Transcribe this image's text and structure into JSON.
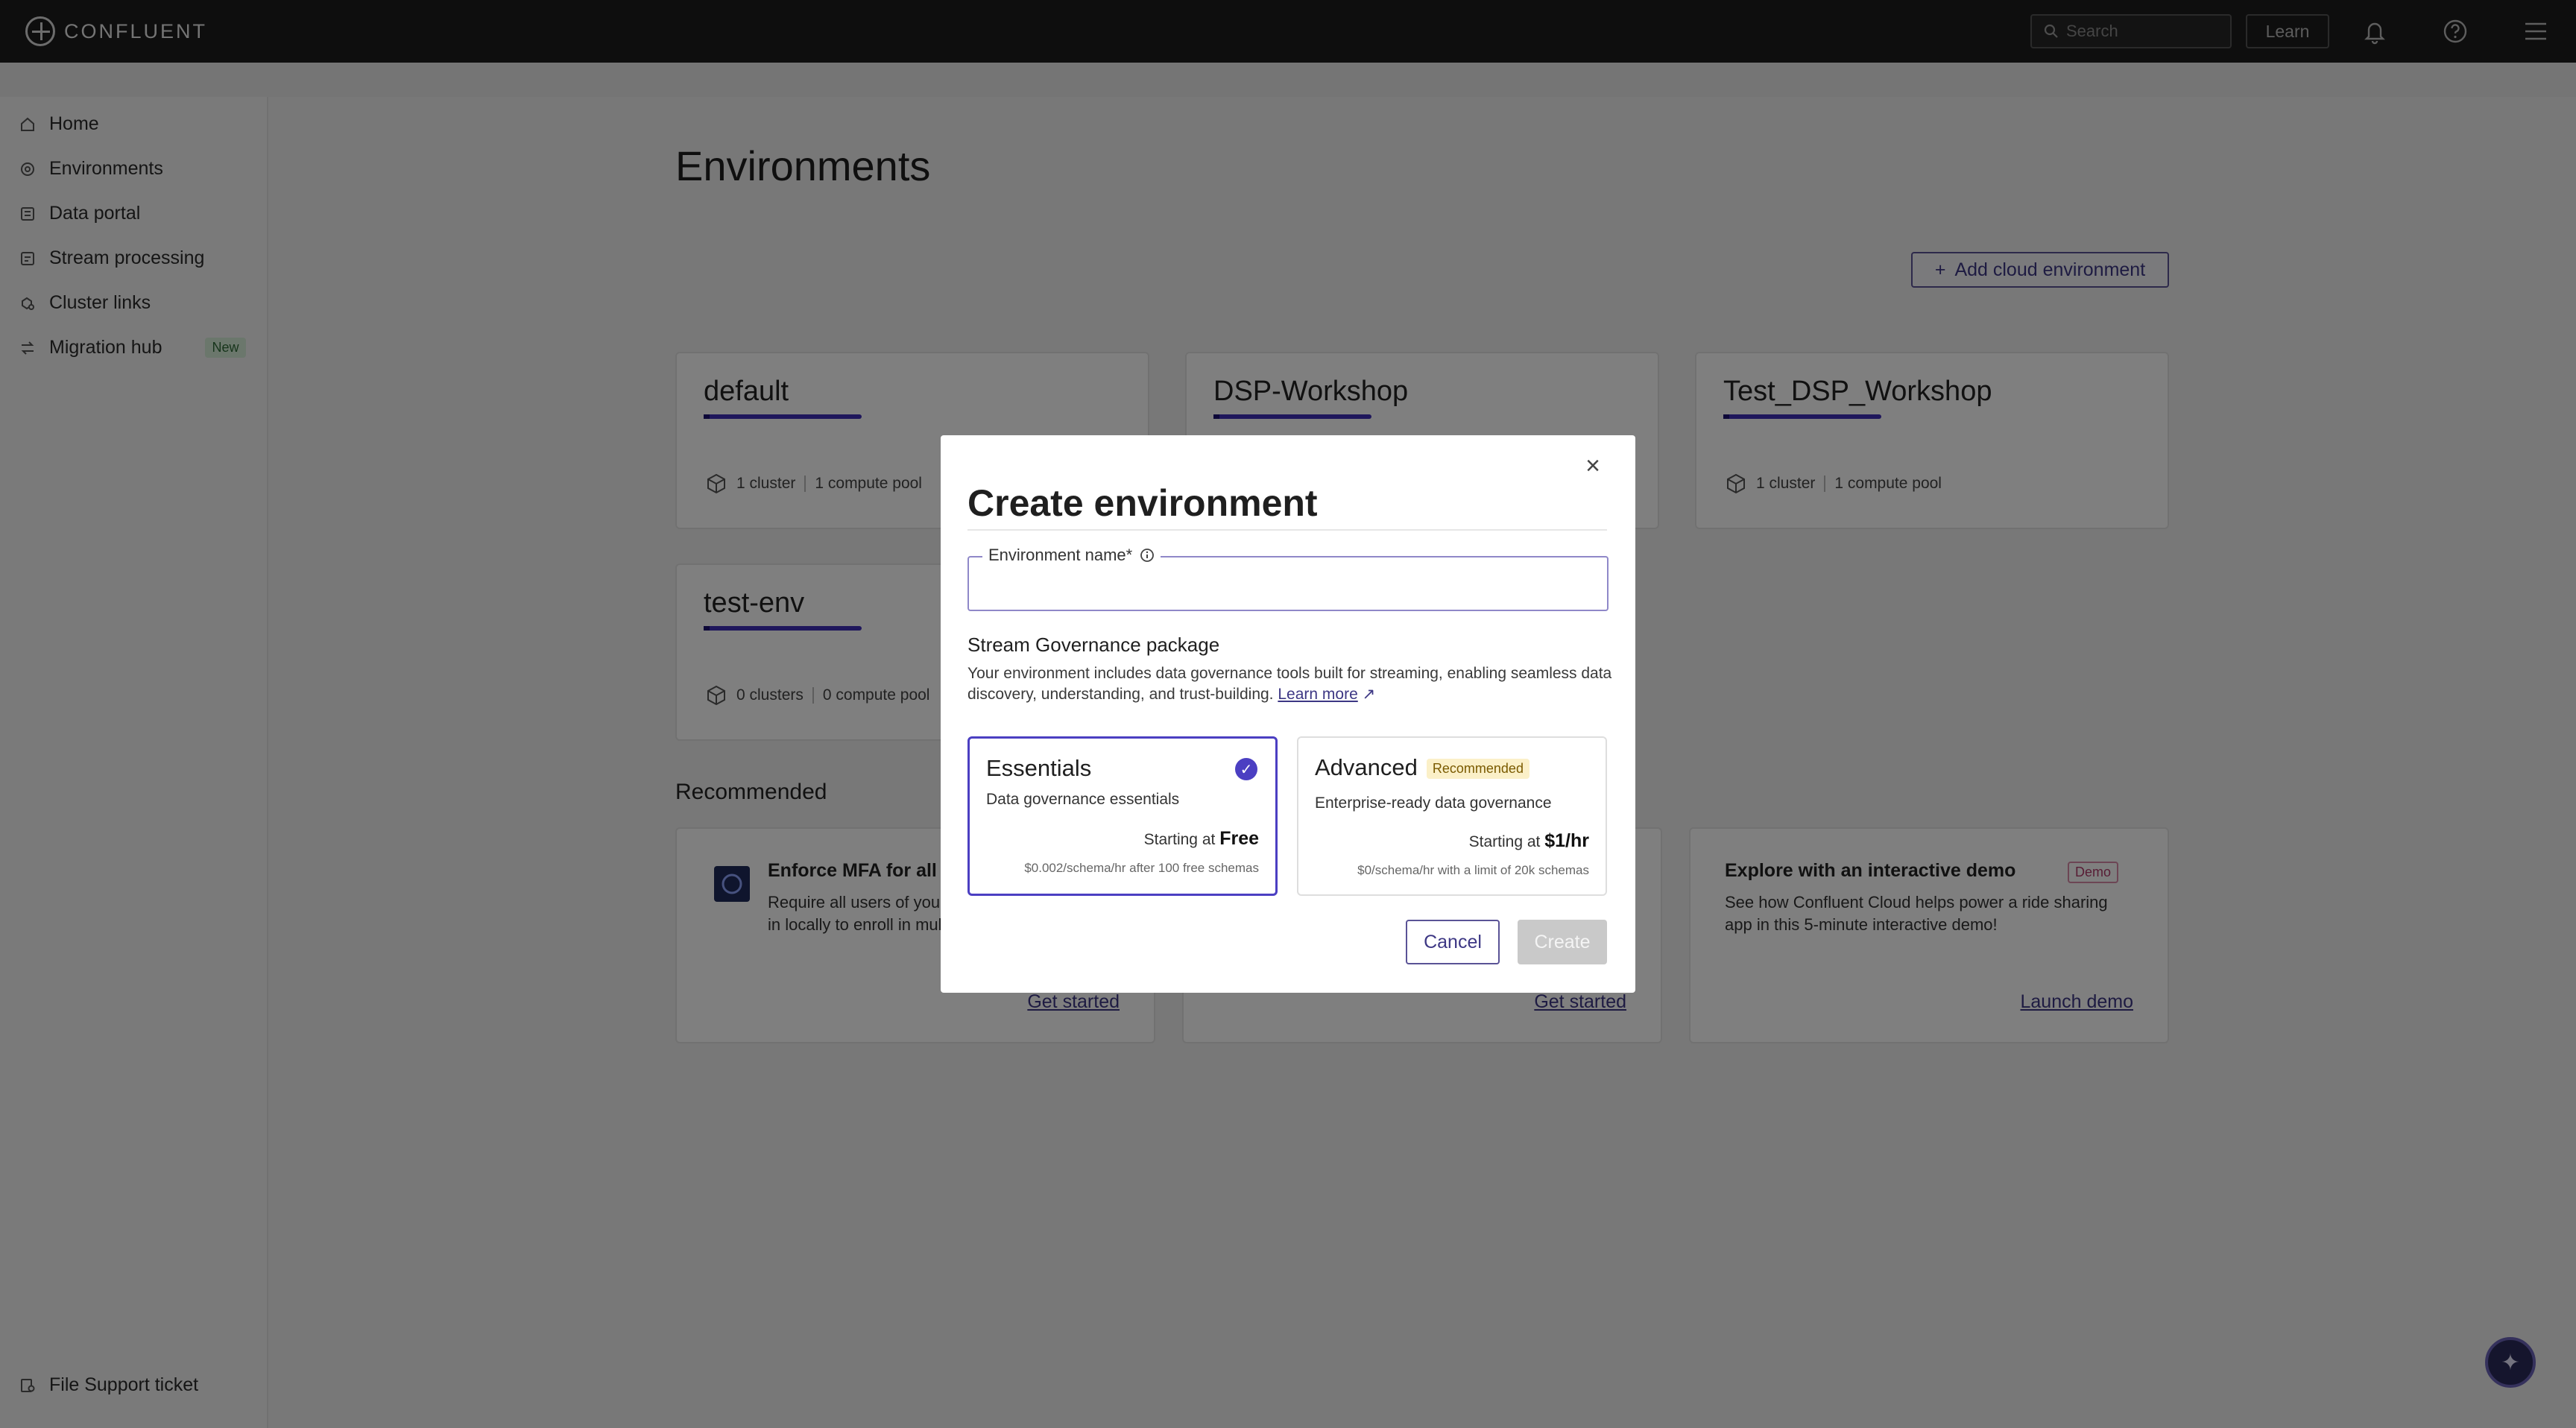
{
  "topbar": {
    "brand": "CONFLUENT",
    "search_placeholder": "Search",
    "learn_label": "Learn",
    "icons": [
      "bell-icon",
      "help-icon",
      "menu-icon"
    ]
  },
  "sidebar": {
    "items": [
      {
        "label": "Home",
        "icon": "home-icon"
      },
      {
        "label": "Environments",
        "icon": "environments-icon"
      },
      {
        "label": "Data portal",
        "icon": "data-portal-icon"
      },
      {
        "label": "Stream processing",
        "icon": "stream-processing-icon"
      },
      {
        "label": "Cluster links",
        "icon": "cluster-links-icon"
      },
      {
        "label": "Migration hub",
        "icon": "migration-hub-icon",
        "badge": "New"
      }
    ],
    "footer": "File Support ticket"
  },
  "main": {
    "title": "Environments",
    "add_button": "Add cloud environment",
    "environments": [
      {
        "name": "default",
        "clusters": "1 cluster",
        "pools": "1 compute pool"
      },
      {
        "name": "DSP-Workshop",
        "clusters": "",
        "pools": ""
      },
      {
        "name": "Test_DSP_Workshop",
        "clusters": "1 cluster",
        "pools": "1 compute pool"
      },
      {
        "name": "test-env",
        "clusters": "0 clusters",
        "pools": "0 compute pool"
      }
    ],
    "recommended_title": "Recommended",
    "recommended": [
      {
        "title": "Enforce MFA for all u",
        "desc": "Require all users of your\nin locally to enroll in mul",
        "link": "Get started"
      },
      {
        "title": "",
        "desc": "",
        "link": "Get started"
      },
      {
        "title": "Explore with an interactive demo",
        "badge": "Demo",
        "desc": "See how Confluent Cloud helps power a ride sharing app in this 5-minute interactive demo!",
        "link": "Launch demo"
      }
    ]
  },
  "modal": {
    "title": "Create environment",
    "field_label": "Environment name*",
    "field_value": "",
    "sg_title": "Stream Governance package",
    "sg_desc": "Your environment includes data governance tools built for streaming, enabling seamless data discovery, understanding, and trust-building.",
    "learn_more": "Learn more",
    "packages": [
      {
        "name": "Essentials",
        "sub": "Data governance essentials",
        "price_prefix": "Starting at",
        "price": "Free",
        "fine": "$0.002/schema/hr after 100 free schemas",
        "selected": true
      },
      {
        "name": "Advanced",
        "badge": "Recommended",
        "sub": "Enterprise-ready data governance",
        "price_prefix": "Starting at",
        "price": "$1/hr",
        "fine": "$0/schema/hr with a limit of 20k schemas",
        "selected": false
      }
    ],
    "cancel": "Cancel",
    "create": "Create"
  },
  "colors": {
    "accent": "#4b3fc2",
    "topbar": "#1d1d1d",
    "link": "#3d3784"
  }
}
